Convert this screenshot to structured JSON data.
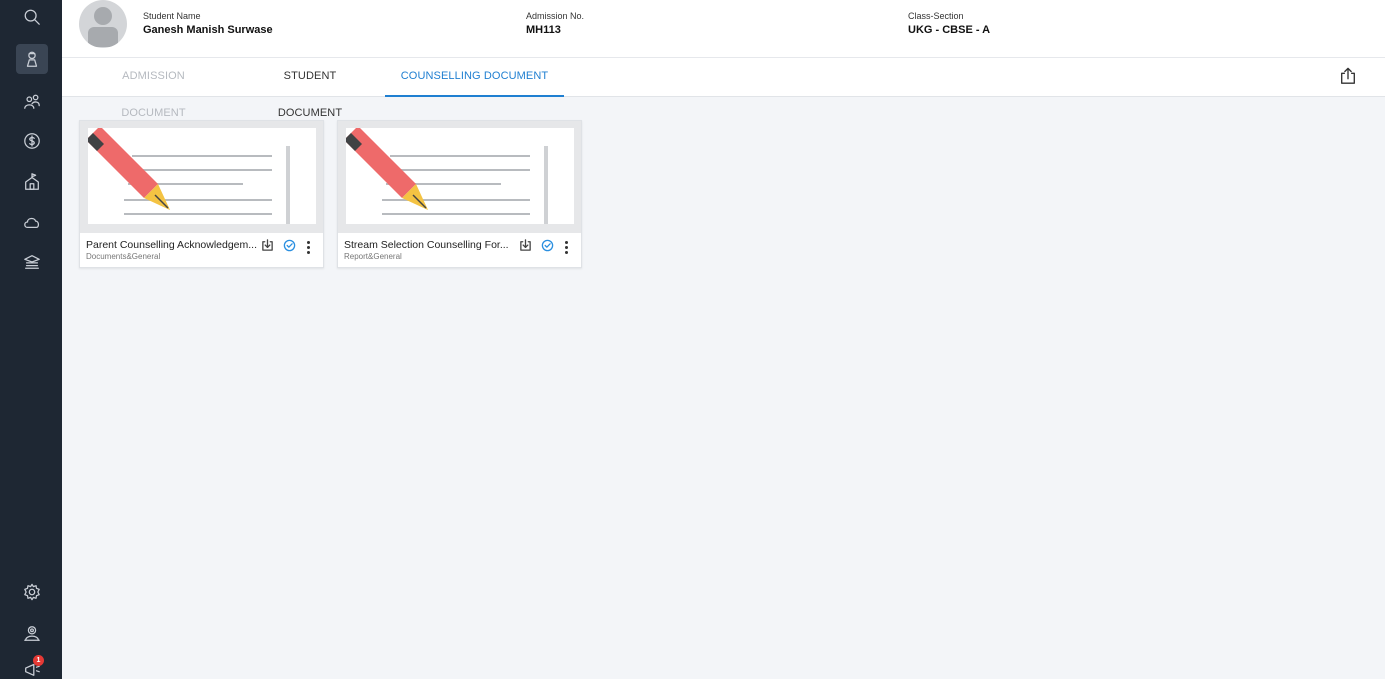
{
  "student": {
    "name_label": "Student Name",
    "name": "Ganesh Manish Surwase",
    "admission_label": "Admission No.",
    "admission_no": "MH113",
    "class_label": "Class-Section",
    "class_section": "UKG - CBSE - A"
  },
  "tabs": [
    {
      "label": "ADMISSION DOCUMENT",
      "state": "disabled"
    },
    {
      "label": "STUDENT DOCUMENT",
      "state": "normal"
    },
    {
      "label": "COUNSELLING DOCUMENT",
      "state": "active"
    }
  ],
  "documents": [
    {
      "title": "Parent Counselling Acknowledgem...",
      "subtitle": "Documents&General"
    },
    {
      "title": "Stream Selection Counselling For...",
      "subtitle": "Report&General"
    }
  ],
  "sidebar": {
    "icons": [
      "search-icon",
      "student-icon",
      "users-icon",
      "fees-icon",
      "home-icon",
      "cloud-icon",
      "school-icon",
      "settings-icon",
      "profile-icon",
      "announcement-icon"
    ],
    "notification_count": "1"
  },
  "colors": {
    "accent": "#1f7fd1",
    "sidebar_bg": "#1e2733",
    "verified": "#2a8fe0"
  }
}
